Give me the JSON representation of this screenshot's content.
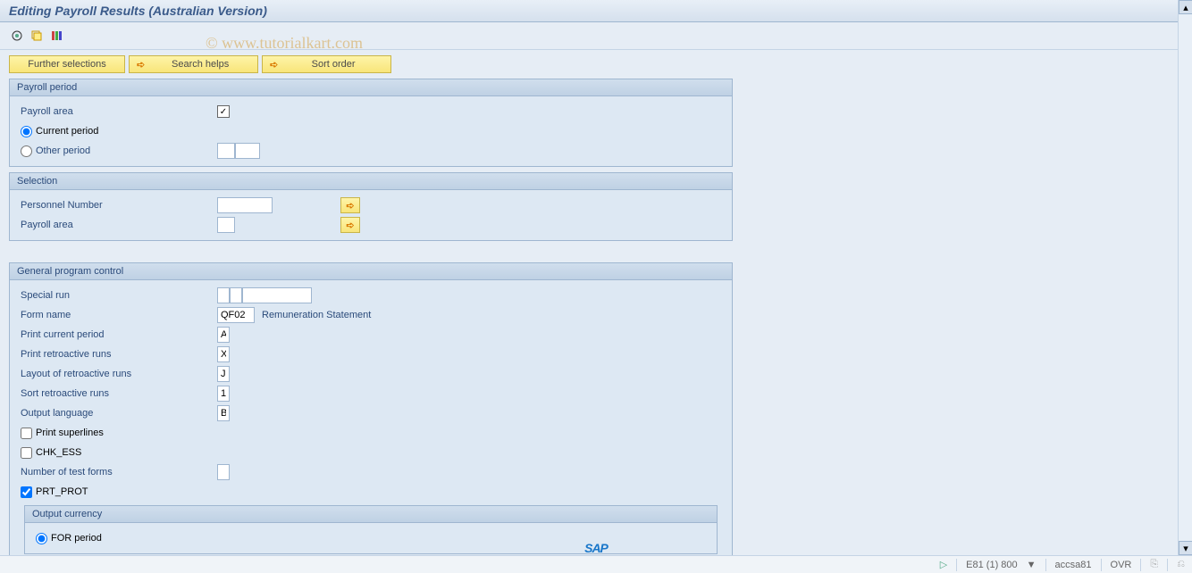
{
  "title": "Editing Payroll Results (Australian Version)",
  "watermark": "© www.tutorialkart.com",
  "buttons": {
    "further_selections": "Further selections",
    "search_helps": "Search helps",
    "sort_order": "Sort order"
  },
  "groups": {
    "payroll_period": {
      "title": "Payroll period",
      "payroll_area_label": "Payroll area",
      "current_period_label": "Current period",
      "other_period_label": "Other period"
    },
    "selection": {
      "title": "Selection",
      "personnel_number_label": "Personnel Number",
      "payroll_area_label": "Payroll area"
    },
    "general": {
      "title": "General program control",
      "special_run_label": "Special run",
      "form_name_label": "Form name",
      "form_name_value": "QF02",
      "form_name_desc": "Remuneration Statement",
      "print_current_label": "Print current period",
      "print_current_value": "A",
      "print_retro_label": "Print retroactive runs",
      "print_retro_value": "X",
      "layout_retro_label": "Layout of retroactive runs",
      "layout_retro_value": "J",
      "sort_retro_label": "Sort retroactive runs",
      "sort_retro_value": "1",
      "output_lang_label": "Output language",
      "output_lang_value": "B",
      "print_superlines_label": "Print superlines",
      "chk_ess_label": "CHK_ESS",
      "num_test_forms_label": "Number of test forms",
      "prt_prot_label": "PRT_PROT",
      "output_currency": {
        "title": "Output currency",
        "for_period_label": "FOR period"
      }
    }
  },
  "status": {
    "system": "E81 (1) 800",
    "server": "accsa81",
    "mode": "OVR"
  },
  "sap": "SAP"
}
